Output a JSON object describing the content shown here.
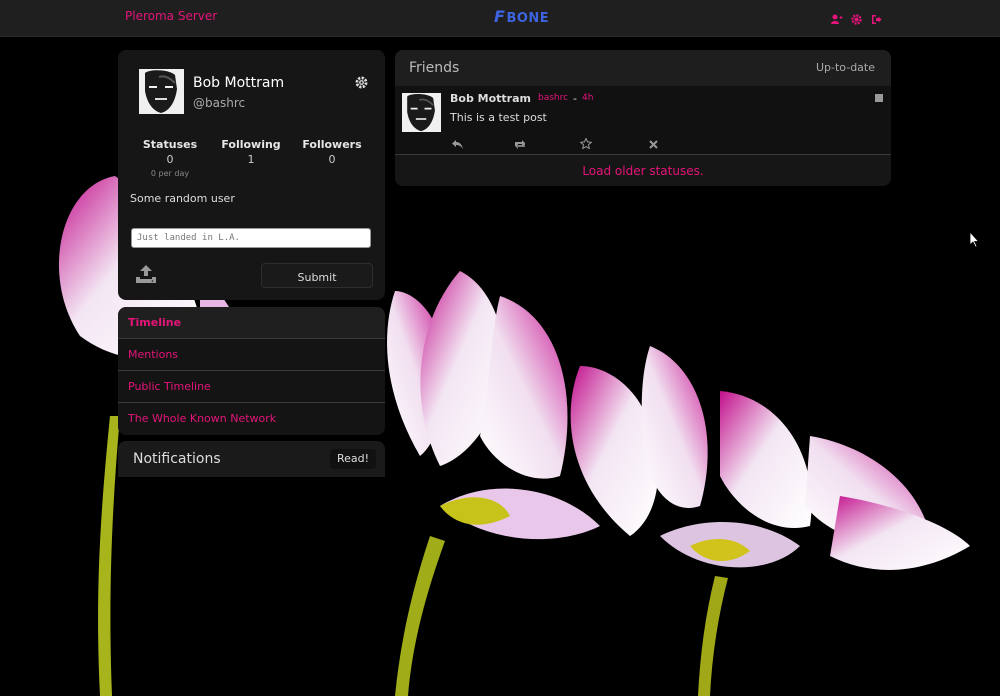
{
  "topbar": {
    "site_name": "Pleroma Server",
    "logo_text": "BONE",
    "logo_letter": "F",
    "icons": [
      "add-user-icon",
      "gear-icon",
      "logout-icon"
    ]
  },
  "user_card": {
    "name": "Bob Mottram",
    "handle": "@bashrc",
    "settings_icon": "gear-icon",
    "stats": [
      {
        "label": "Statuses",
        "value": "0",
        "sub": "0 per day"
      },
      {
        "label": "Following",
        "value": "1",
        "sub": ""
      },
      {
        "label": "Followers",
        "value": "0",
        "sub": ""
      }
    ],
    "bio": "Some random user"
  },
  "composer": {
    "placeholder": "Just landed in L.A.",
    "upload_icon": "upload-icon",
    "submit_label": "Submit"
  },
  "nav": {
    "items": [
      {
        "label": "Timeline"
      },
      {
        "label": "Mentions"
      },
      {
        "label": "Public Timeline"
      },
      {
        "label": "The Whole Known Network"
      }
    ]
  },
  "notifications": {
    "title": "Notifications",
    "read_label": "Read!"
  },
  "timeline": {
    "title": "Friends",
    "status_text": "Up-to-date",
    "statuses": [
      {
        "author": "Bob Mottram",
        "handle": "bashrc",
        "separator": "-",
        "time": "4h",
        "text": "This is a test post",
        "actions": [
          "reply-icon",
          "retweet-icon",
          "favorite-icon",
          "delete-icon"
        ]
      }
    ],
    "load_older": "Load older statuses."
  },
  "colors": {
    "accent": "#e5147a",
    "background": "#000000",
    "panel": "#161616",
    "logo": "#3d64e0"
  }
}
